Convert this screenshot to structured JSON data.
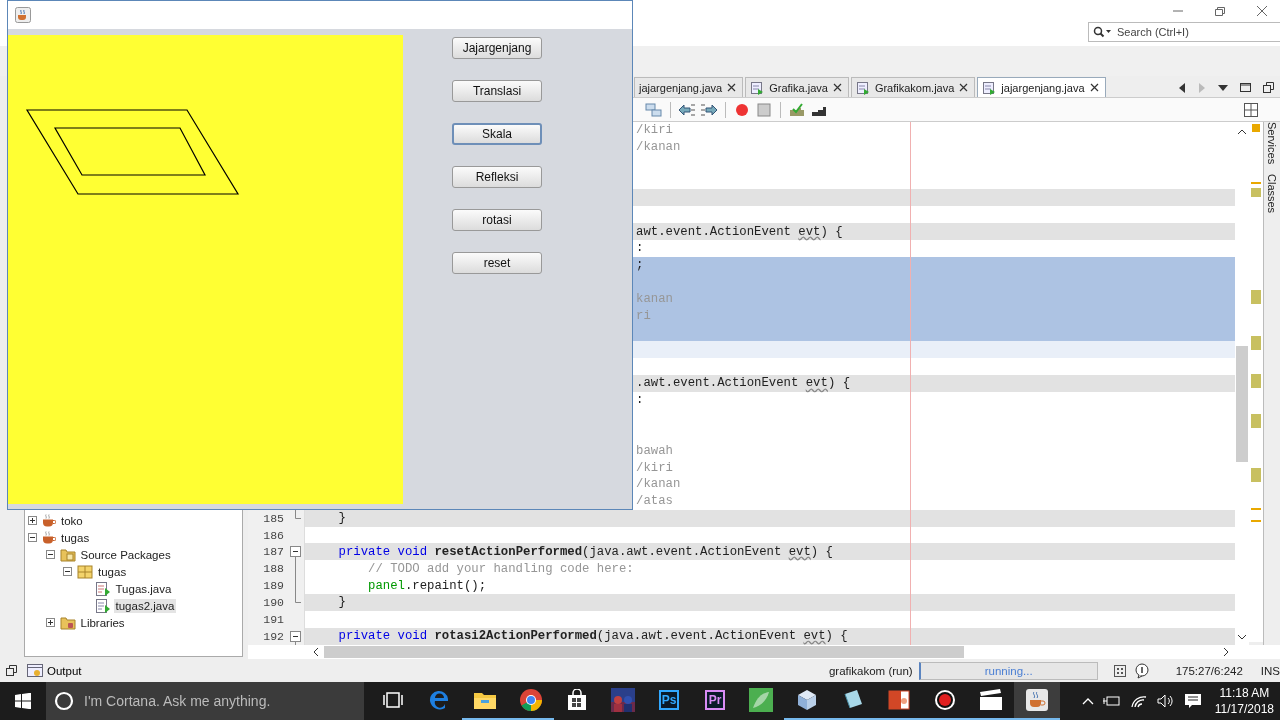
{
  "ide": {
    "search": {
      "placeholder": "Search (Ctrl+I)"
    },
    "editor_tabs": [
      {
        "label": "jajargenjang.java",
        "selected": false
      },
      {
        "label": "Grafika.java",
        "selected": false
      },
      {
        "label": "Grafikakom.java",
        "selected": false
      },
      {
        "label": "jajargenjang.java",
        "selected": true
      }
    ],
    "side_panels": [
      "Services",
      "Classes"
    ],
    "code_lines": [
      {
        "kind": "plain",
        "tokens": [
          {
            "kind": "comment",
            "text": "/kiri"
          }
        ]
      },
      {
        "kind": "plain",
        "tokens": [
          {
            "kind": "comment",
            "text": "/kanan"
          }
        ]
      },
      {
        "kind": "plain"
      },
      {
        "kind": "plain"
      },
      {
        "kind": "guarded"
      },
      {
        "kind": "plain"
      },
      {
        "kind": "guarded",
        "tokens": [
          {
            "kind": "plain",
            "text": "awt.event.ActionEvent "
          },
          {
            "kind": "unused",
            "text": "evt"
          },
          {
            "kind": "plain",
            "text": ") {"
          }
        ]
      },
      {
        "kind": "plain",
        "tokens": [
          {
            "kind": "plain",
            "text": ":"
          }
        ]
      },
      {
        "kind": "selected",
        "tokens": [
          {
            "kind": "plain",
            "text": ";"
          }
        ]
      },
      {
        "kind": "selected"
      },
      {
        "kind": "selected",
        "tokens": [
          {
            "kind": "comment",
            "text": "kanan"
          }
        ]
      },
      {
        "kind": "selected",
        "tokens": [
          {
            "kind": "comment",
            "text": "ri"
          }
        ]
      },
      {
        "kind": "selected"
      },
      {
        "kind": "current"
      },
      {
        "kind": "plain"
      },
      {
        "kind": "guarded",
        "tokens": [
          {
            "kind": "plain",
            "text": ".awt.event.ActionEvent "
          },
          {
            "kind": "unused",
            "text": "evt"
          },
          {
            "kind": "plain",
            "text": ") {"
          }
        ]
      },
      {
        "kind": "plain",
        "tokens": [
          {
            "kind": "plain",
            "text": ":"
          }
        ]
      },
      {
        "kind": "plain"
      },
      {
        "kind": "plain"
      },
      {
        "kind": "plain",
        "tokens": [
          {
            "kind": "comment",
            "text": "bawah"
          }
        ]
      },
      {
        "kind": "plain",
        "tokens": [
          {
            "kind": "comment",
            "text": "/kiri"
          }
        ]
      },
      {
        "kind": "plain",
        "tokens": [
          {
            "kind": "comment",
            "text": "/kanan"
          }
        ]
      },
      {
        "kind": "plain",
        "tokens": [
          {
            "kind": "comment",
            "text": "/atas"
          }
        ]
      },
      {
        "kind": "guarded",
        "number": "185",
        "fold_end": true,
        "tokens": [
          {
            "kind": "plain",
            "text": "    }"
          }
        ]
      },
      {
        "kind": "plain",
        "number": "186"
      },
      {
        "kind": "guarded",
        "number": "187",
        "fold_open": true,
        "tokens": [
          {
            "kind": "keyword",
            "text": "    private void "
          },
          {
            "kind": "method",
            "text": "resetActionPerformed"
          },
          {
            "kind": "plain",
            "text": "(java.awt.event.ActionEvent "
          },
          {
            "kind": "unused",
            "text": "evt"
          },
          {
            "kind": "plain",
            "text": ") {"
          }
        ]
      },
      {
        "kind": "plain",
        "number": "188",
        "fold_body": true,
        "tokens": [
          {
            "kind": "comment",
            "text": "        // TODO add your handling code here:"
          }
        ]
      },
      {
        "kind": "plain",
        "number": "189",
        "fold_body": true,
        "tokens": [
          {
            "kind": "field",
            "text": "        panel"
          },
          {
            "kind": "plain",
            "text": ".repaint();"
          }
        ]
      },
      {
        "kind": "guarded",
        "number": "190",
        "fold_end": true,
        "tokens": [
          {
            "kind": "plain",
            "text": "    }"
          }
        ]
      },
      {
        "kind": "plain",
        "number": "191"
      },
      {
        "kind": "guarded",
        "number": "192",
        "fold_open": true,
        "tokens": [
          {
            "kind": "keyword",
            "text": "    private void "
          },
          {
            "kind": "method",
            "text": "rotasi2ActionPerformed"
          },
          {
            "kind": "plain",
            "text": "(java.awt.event.ActionEvent "
          },
          {
            "kind": "unused",
            "text": "evt"
          },
          {
            "kind": "plain",
            "text": ") {"
          }
        ]
      }
    ],
    "project_tree": [
      {
        "label": "toko",
        "kind": "project",
        "expanded": false,
        "selected": false
      },
      {
        "label": "tugas",
        "kind": "project",
        "expanded": true,
        "selected": false,
        "children": [
          {
            "label": "Source Packages",
            "kind": "source",
            "expanded": true,
            "selected": false,
            "children": [
              {
                "label": "tugas",
                "kind": "package",
                "expanded": true,
                "selected": false,
                "children": [
                  {
                    "label": "Tugas.java",
                    "kind": "form",
                    "selected": false
                  },
                  {
                    "label": "tugas2.java",
                    "kind": "class",
                    "selected": true
                  }
                ]
              }
            ]
          },
          {
            "label": "Libraries",
            "kind": "library",
            "expanded": false,
            "selected": false
          }
        ]
      }
    ],
    "output_tab": "Output",
    "status": {
      "task": "grafikakom (run)",
      "progress_text": "running...",
      "position": "175:27/6:242",
      "mode": "INS"
    }
  },
  "app_window": {
    "buttons": [
      {
        "label": "Jajargenjang",
        "focused": false
      },
      {
        "label": "Translasi",
        "focused": false
      },
      {
        "label": "Skala",
        "focused": true
      },
      {
        "label": "Refleksi",
        "focused": false
      },
      {
        "label": "rotasi",
        "focused": false
      },
      {
        "label": "reset",
        "focused": false
      }
    ]
  },
  "taskbar": {
    "search_placeholder": "I'm Cortana. Ask me anything.",
    "apps": [
      {
        "kind": "taskview",
        "running": false,
        "selected": false
      },
      {
        "kind": "edge",
        "running": false,
        "selected": false
      },
      {
        "kind": "explorer",
        "running": true,
        "selected": false
      },
      {
        "kind": "chrome",
        "running": true,
        "selected": false
      },
      {
        "kind": "store",
        "running": false,
        "selected": false
      },
      {
        "kind": "game",
        "running": false,
        "selected": false
      },
      {
        "kind": "tile",
        "label": "Ps",
        "color": "#31a8ff",
        "running": false,
        "selected": false
      },
      {
        "kind": "tile",
        "label": "Pr",
        "color": "#d98cf5",
        "running": false,
        "selected": false
      },
      {
        "kind": "leaf",
        "running": false,
        "selected": false
      },
      {
        "kind": "cube",
        "running": true,
        "selected": false
      },
      {
        "kind": "notepad",
        "running": true,
        "selected": false
      },
      {
        "kind": "slides",
        "running": true,
        "selected": false
      },
      {
        "kind": "record",
        "running": true,
        "selected": false
      },
      {
        "kind": "clapper",
        "running": true,
        "selected": false
      },
      {
        "kind": "java",
        "running": true,
        "selected": true
      }
    ],
    "time": "11:18 AM",
    "date": "11/17/2018"
  }
}
